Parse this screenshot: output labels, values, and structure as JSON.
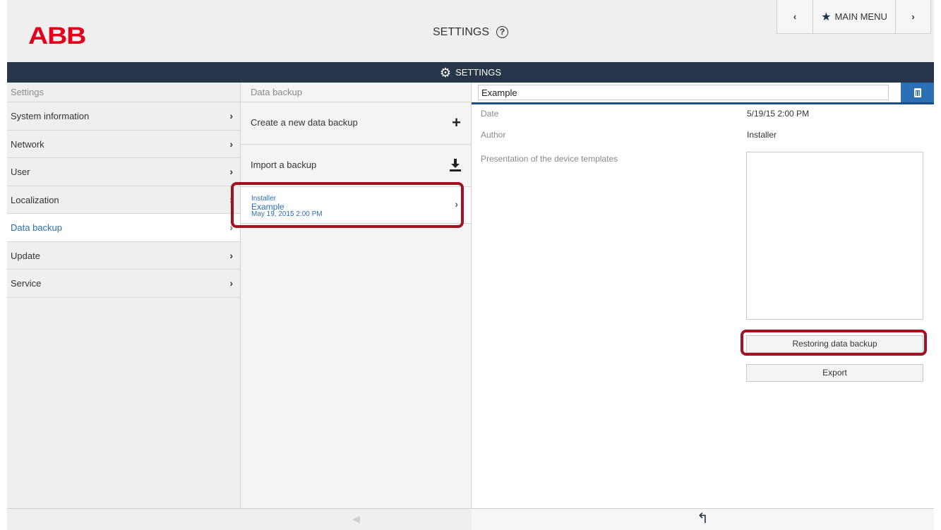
{
  "header": {
    "logo": "ABB",
    "title": "SETTINGS",
    "help_icon": "?",
    "nav": {
      "prev_icon": "‹",
      "main_menu_label": "MAIN MENU",
      "main_menu_icon": "★",
      "next_icon": "›"
    }
  },
  "bar": {
    "label": "SETTINGS",
    "icon": "gear-icon"
  },
  "settings_column": {
    "heading": "Settings",
    "items": [
      {
        "label": "System information",
        "active": false
      },
      {
        "label": "Network",
        "active": false
      },
      {
        "label": "User",
        "active": false
      },
      {
        "label": "Localization",
        "active": false
      },
      {
        "label": "Data backup",
        "active": true
      },
      {
        "label": "Update",
        "active": false
      },
      {
        "label": "Service",
        "active": false
      }
    ]
  },
  "backup_column": {
    "heading": "Data backup",
    "create_label": "Create a new data backup",
    "create_icon": "+",
    "import_label": "Import a backup",
    "import_icon": "download-icon",
    "entries": [
      {
        "author": "Installer",
        "name": "Example",
        "date": "May 19, 2015 2:00 PM"
      }
    ]
  },
  "detail": {
    "name_value": "Example",
    "date_label": "Date",
    "date_value": "5/19/15 2:00 PM",
    "author_label": "Author",
    "author_value": "Installer",
    "templates_label": "Presentation of the device templates",
    "restore_button": "Restoring data backup",
    "export_button": "Export"
  },
  "footer": {
    "back_icon": "↰"
  },
  "colors": {
    "brand_red": "#e2001a",
    "dark_bar": "#27354a",
    "accent_blue": "#2b6fb4",
    "highlight": "#a31220"
  }
}
